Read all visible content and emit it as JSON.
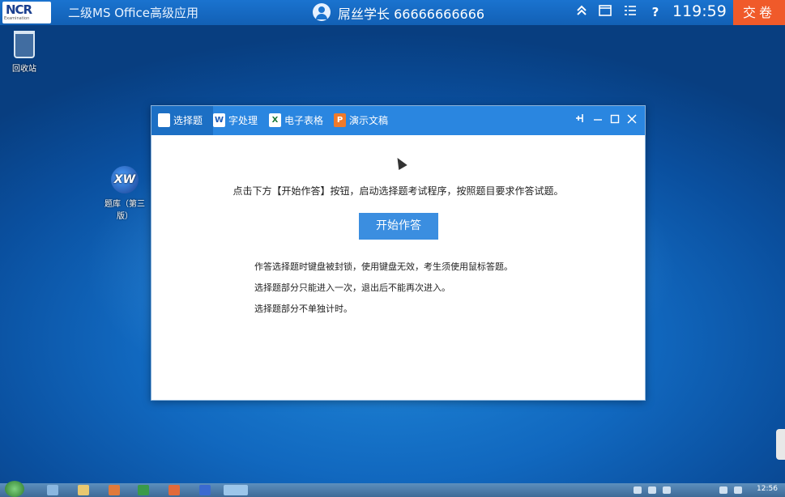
{
  "topbar": {
    "logo_text": "NCR",
    "logo_sub": "Examination",
    "exam_title": "二级MS Office高级应用",
    "user_info": "屌丝学长 66666666666",
    "timer": "119:59",
    "submit_label": "交卷",
    "icons": [
      "collapse-icon",
      "window-icon",
      "list-icon",
      "help-icon"
    ],
    "help_label": "?"
  },
  "desktop": {
    "recycle_label": "回收站",
    "xw_label": "题库（第三版）",
    "xw_glyph": "XW"
  },
  "window": {
    "tabs": [
      {
        "label": "选择题",
        "icon": "doc-icon",
        "active": true
      },
      {
        "label": "字处理",
        "icon": "word-icon",
        "active": false
      },
      {
        "label": "电子表格",
        "icon": "excel-icon",
        "active": false
      },
      {
        "label": "演示文稿",
        "icon": "ppt-icon",
        "active": false
      }
    ],
    "tab_icon_letters": {
      "word": "W",
      "excel": "X",
      "ppt": "P"
    },
    "instruction": "点击下方【开始作答】按钮，启动选择题考试程序，按照题目要求作答试题。",
    "start_button": "开始作答",
    "notes": [
      "作答选择题时键盘被封锁，使用键盘无效，考生须使用鼠标答题。",
      "选择题部分只能进入一次，退出后不能再次进入。",
      "选择题部分不单独计时。"
    ],
    "controls": [
      "pin-icon",
      "minimize-icon",
      "maximize-icon",
      "close-icon"
    ]
  },
  "taskbar": {
    "clock": "12:56"
  },
  "colors": {
    "accent": "#2a86e0",
    "submit": "#f05a2a",
    "button": "#3b8ee0"
  }
}
